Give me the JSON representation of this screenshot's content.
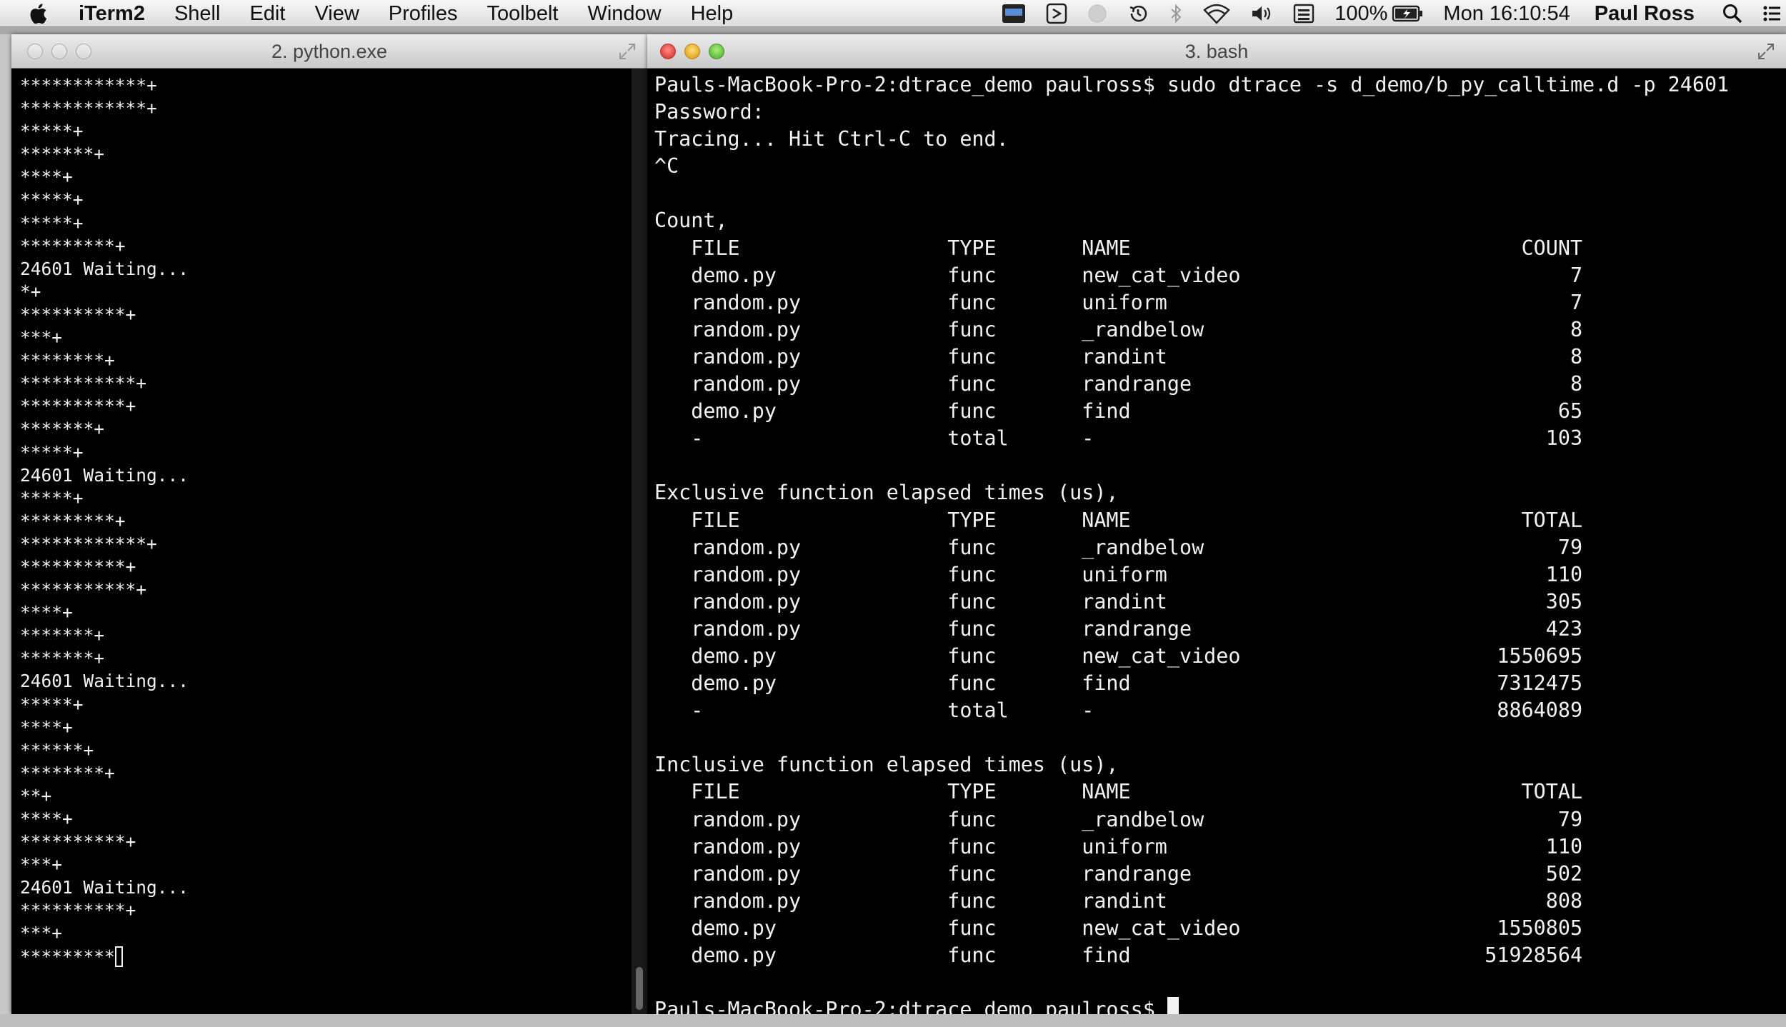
{
  "menubar": {
    "app_name": "iTerm2",
    "menus": [
      "Shell",
      "Edit",
      "View",
      "Profiles",
      "Toolbelt",
      "Window",
      "Help"
    ],
    "battery": "100%",
    "clock": "Mon 16:10:54",
    "user": "Paul Ross",
    "icons": [
      "apple-icon",
      "gpu-icon",
      "dash-icon",
      "sync-icon",
      "time-machine-icon",
      "bluetooth-icon",
      "wifi-icon",
      "volume-icon",
      "keyboard-icon",
      "battery-icon",
      "spotlight-icon",
      "notification-center-icon"
    ]
  },
  "left_window": {
    "title": "2. python.exe",
    "output": "************+\n************+\n*****+\n*******+\n****+\n*****+\n*****+\n*********+\n24601 Waiting...\n*+\n**********+\n***+\n********+\n***********+\n**********+\n*******+\n*****+\n24601 Waiting...\n*****+\n*********+\n************+\n**********+\n***********+\n****+\n*******+\n*******+\n24601 Waiting...\n*****+\n****+\n******+\n********+\n**+\n****+\n**********+\n***+\n24601 Waiting...\n**********+\n***+",
    "last_line": "*********"
  },
  "right_window": {
    "title": "3. bash",
    "output": "Pauls-MacBook-Pro-2:dtrace_demo paulross$ sudo dtrace -s d_demo/b_py_calltime.d -p 24601\nPassword:\nTracing... Hit Ctrl-C to end.\n^C\n\nCount,\n   FILE                 TYPE       NAME                                COUNT\n   demo.py              func       new_cat_video                           7\n   random.py            func       uniform                                 7\n   random.py            func       _randbelow                              8\n   random.py            func       randint                                 8\n   random.py            func       randrange                               8\n   demo.py              func       find                                   65\n   -                    total      -                                     103\n\nExclusive function elapsed times (us),\n   FILE                 TYPE       NAME                                TOTAL\n   random.py            func       _randbelow                             79\n   random.py            func       uniform                               110\n   random.py            func       randint                               305\n   random.py            func       randrange                             423\n   demo.py              func       new_cat_video                     1550695\n   demo.py              func       find                              7312475\n   -                    total      -                                 8864089\n\nInclusive function elapsed times (us),\n   FILE                 TYPE       NAME                                TOTAL\n   random.py            func       _randbelow                             79\n   random.py            func       uniform                               110\n   random.py            func       randrange                             502\n   random.py            func       randint                               808\n   demo.py              func       new_cat_video                     1550805\n   demo.py              func       find                             51928564\n",
    "prompt": "Pauls-MacBook-Pro-2:dtrace_demo paulross$ "
  }
}
